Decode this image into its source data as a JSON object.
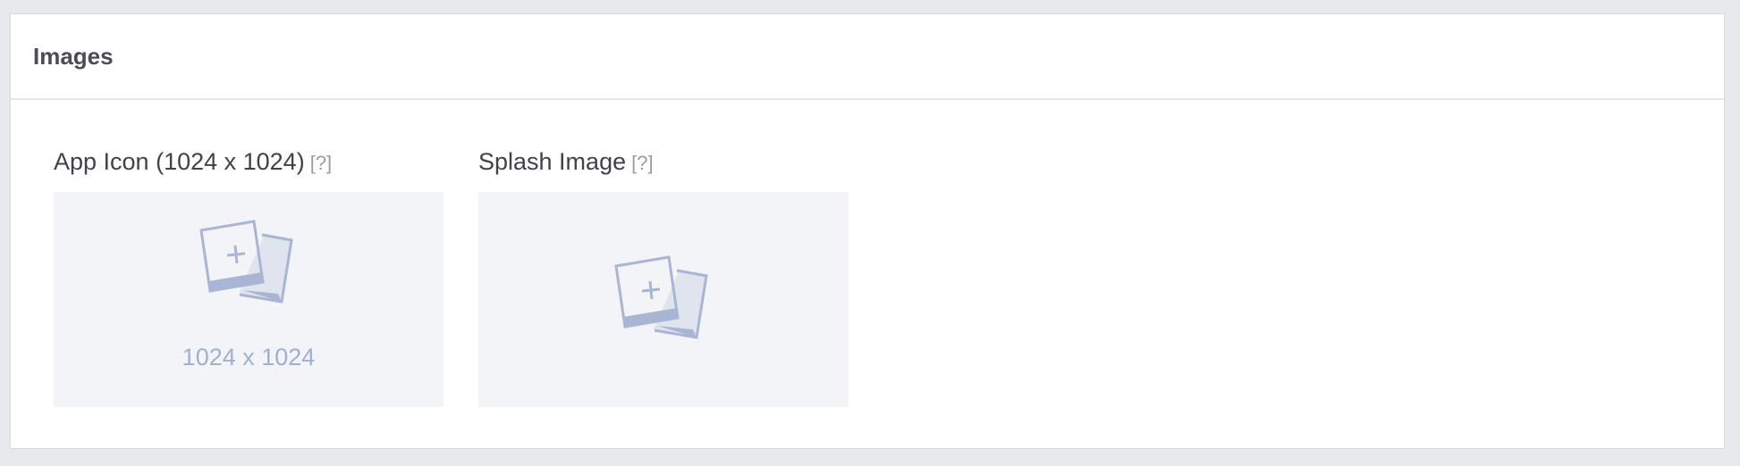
{
  "section": {
    "title": "Images"
  },
  "fields": [
    {
      "label": "App Icon (1024 x 1024)",
      "help": "[?]",
      "placeholder_dims": "1024 x 1024",
      "icon": "add-image-icon"
    },
    {
      "label": "Splash Image",
      "help": "[?]",
      "icon": "add-image-icon"
    }
  ],
  "colors": {
    "page_bg": "#e8e9ed",
    "panel_bg": "#ffffff",
    "dropzone_bg": "#f3f4f7",
    "icon": "#a9b5d4"
  }
}
